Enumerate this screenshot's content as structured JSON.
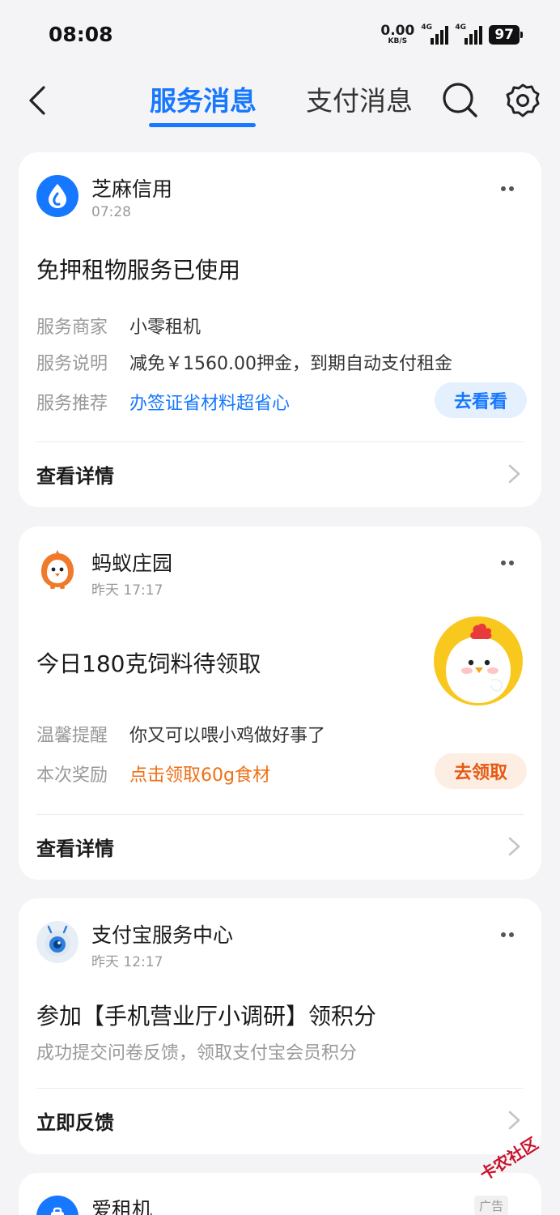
{
  "status_bar": {
    "time": "08:08",
    "net_speed": "0.00",
    "net_unit": "KB/S",
    "sig1_tag": "4G",
    "sig2_tag": "4G",
    "battery": "97"
  },
  "header": {
    "tabs": [
      {
        "label": "服务消息",
        "active": true
      },
      {
        "label": "支付消息",
        "active": false
      }
    ],
    "icons": [
      "back-arrow-icon",
      "search-icon",
      "gear-icon"
    ],
    "accent_color": "#1677ff"
  },
  "cards": [
    {
      "source": "芝麻信用",
      "time": "07:28",
      "title": "免押租物服务已使用",
      "rows": [
        {
          "key": "服务商家",
          "value": "小零租机"
        },
        {
          "key": "服务说明",
          "value": "减免￥1560.00押金，到期自动支付租金"
        },
        {
          "key": "服务推荐",
          "value": "办签证省材料超省心"
        }
      ],
      "action": "去看看",
      "footer": "查看详情"
    },
    {
      "source": "蚂蚁庄园",
      "time": "昨天 17:17",
      "title": "今日180克饲料待领取",
      "rows": [
        {
          "key": "温馨提醒",
          "value": "你又可以喂小鸡做好事了"
        },
        {
          "key": "本次奖励",
          "value": "点击领取60g食材"
        }
      ],
      "action": "去领取",
      "footer": "查看详情"
    },
    {
      "source": "支付宝服务中心",
      "time": "昨天 12:17",
      "title": "参加【手机营业厅小调研】领积分",
      "subtext": "成功提交问卷反馈，领取支付宝会员积分",
      "footer": "立即反馈"
    },
    {
      "source": "爱租机",
      "ad_label": "广告"
    }
  ],
  "watermark": "卡农社区"
}
